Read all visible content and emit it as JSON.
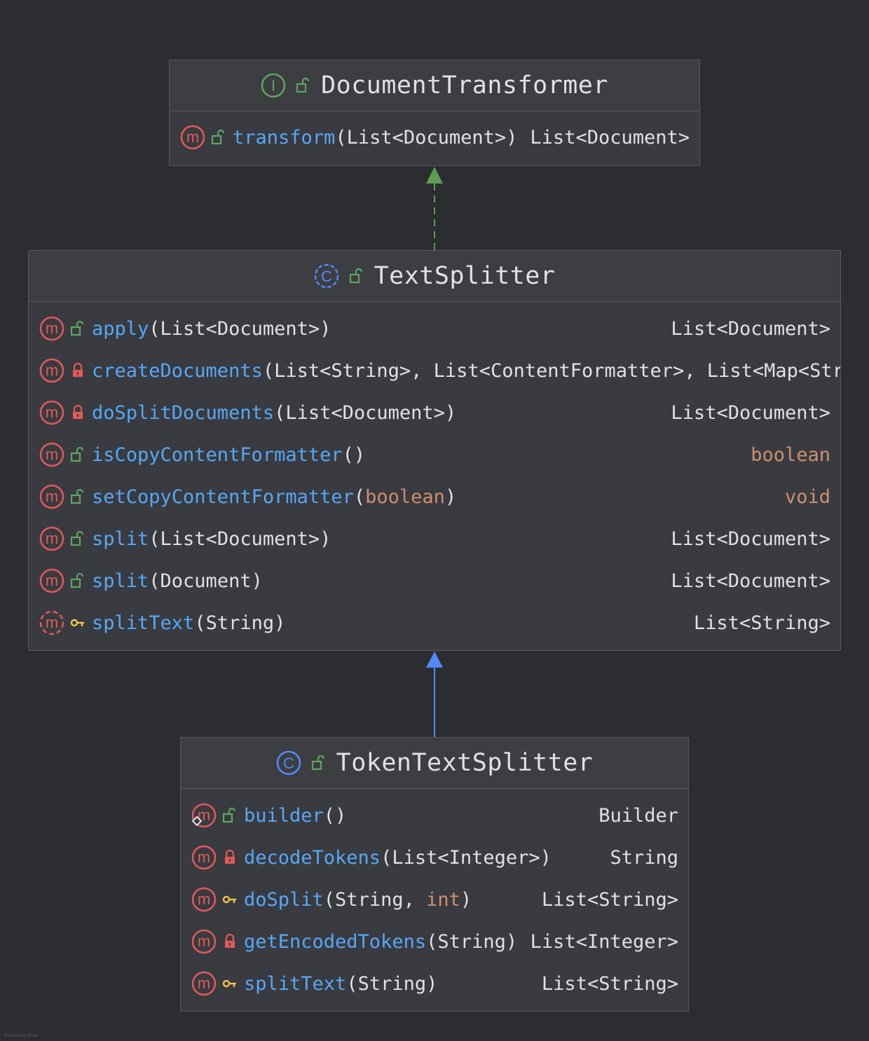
{
  "colors": {
    "background": "#2b2d30",
    "method_name": "#56a8f5",
    "primitive": "#cf8e6d",
    "public_icon": "#5fa463",
    "private_icon": "#e05a5a",
    "protected_icon": "#f0c64a",
    "interface_icon": "#5fa463",
    "class_icon": "#548af7",
    "realization_arrow": "#5c9c53",
    "inheritance_arrow": "#548af7"
  },
  "document_transformer": {
    "title": "DocumentTransformer",
    "kind_icon": "interface-icon",
    "visibility_icon": "public-icon",
    "methods": [
      {
        "name": "transform",
        "args": "(List<Document>)",
        "ret": "List<Document>",
        "visibility": "public"
      }
    ]
  },
  "text_splitter": {
    "title": "TextSplitter",
    "kind_icon": "abstract-class-icon",
    "visibility_icon": "public-icon",
    "methods": [
      {
        "name": "apply",
        "args": "(List<Document>)",
        "ret": "List<Document>",
        "visibility": "public"
      },
      {
        "name": "createDocuments",
        "args": "(List<String>, List<ContentFormatter>, List<Map<Str",
        "ret": "",
        "visibility": "private"
      },
      {
        "name": "doSplitDocuments",
        "args": "(List<Document>)",
        "ret": "List<Document>",
        "visibility": "private"
      },
      {
        "name": "isCopyContentFormatter",
        "args": "()",
        "ret": "boolean",
        "visibility": "public"
      },
      {
        "name": "setCopyContentFormatter",
        "args_open": "(",
        "args_prim": "boolean",
        "args_close": ")",
        "ret": "void",
        "visibility": "public"
      },
      {
        "name": "split",
        "args": "(List<Document>)",
        "ret": "List<Document>",
        "visibility": "public"
      },
      {
        "name": "split",
        "args": "(Document)",
        "ret": "List<Document>",
        "visibility": "public"
      },
      {
        "name": "splitText",
        "args": "(String)",
        "ret": "List<String>",
        "visibility": "protected"
      }
    ]
  },
  "token_text_splitter": {
    "title": "TokenTextSplitter",
    "kind_icon": "class-icon",
    "visibility_icon": "public-icon",
    "methods": [
      {
        "name": "builder",
        "args": "()",
        "ret": "Builder",
        "visibility": "public"
      },
      {
        "name": "decodeTokens",
        "args": "(List<Integer>)",
        "ret": "String",
        "visibility": "private"
      },
      {
        "name": "doSplit",
        "args_open": "(String, ",
        "args_prim": "int",
        "args_close": ")",
        "ret": "List<String>",
        "visibility": "protected"
      },
      {
        "name": "getEncodedTokens",
        "args": "(String)",
        "ret": "List<Integer>",
        "visibility": "private"
      },
      {
        "name": "splitText",
        "args": "(String)",
        "ret": "List<String>",
        "visibility": "protected"
      }
    ]
  }
}
